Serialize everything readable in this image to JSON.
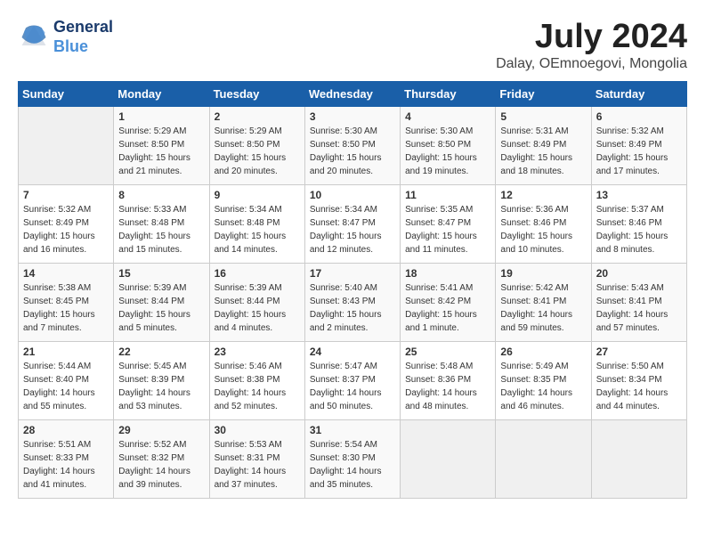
{
  "logo": {
    "line1": "General",
    "line2": "Blue"
  },
  "title": "July 2024",
  "subtitle": "Dalay, OEmnoegovi, Mongolia",
  "weekdays": [
    "Sunday",
    "Monday",
    "Tuesday",
    "Wednesday",
    "Thursday",
    "Friday",
    "Saturday"
  ],
  "weeks": [
    [
      {
        "day": "",
        "info": ""
      },
      {
        "day": "1",
        "info": "Sunrise: 5:29 AM\nSunset: 8:50 PM\nDaylight: 15 hours\nand 21 minutes."
      },
      {
        "day": "2",
        "info": "Sunrise: 5:29 AM\nSunset: 8:50 PM\nDaylight: 15 hours\nand 20 minutes."
      },
      {
        "day": "3",
        "info": "Sunrise: 5:30 AM\nSunset: 8:50 PM\nDaylight: 15 hours\nand 20 minutes."
      },
      {
        "day": "4",
        "info": "Sunrise: 5:30 AM\nSunset: 8:50 PM\nDaylight: 15 hours\nand 19 minutes."
      },
      {
        "day": "5",
        "info": "Sunrise: 5:31 AM\nSunset: 8:49 PM\nDaylight: 15 hours\nand 18 minutes."
      },
      {
        "day": "6",
        "info": "Sunrise: 5:32 AM\nSunset: 8:49 PM\nDaylight: 15 hours\nand 17 minutes."
      }
    ],
    [
      {
        "day": "7",
        "info": "Sunrise: 5:32 AM\nSunset: 8:49 PM\nDaylight: 15 hours\nand 16 minutes."
      },
      {
        "day": "8",
        "info": "Sunrise: 5:33 AM\nSunset: 8:48 PM\nDaylight: 15 hours\nand 15 minutes."
      },
      {
        "day": "9",
        "info": "Sunrise: 5:34 AM\nSunset: 8:48 PM\nDaylight: 15 hours\nand 14 minutes."
      },
      {
        "day": "10",
        "info": "Sunrise: 5:34 AM\nSunset: 8:47 PM\nDaylight: 15 hours\nand 12 minutes."
      },
      {
        "day": "11",
        "info": "Sunrise: 5:35 AM\nSunset: 8:47 PM\nDaylight: 15 hours\nand 11 minutes."
      },
      {
        "day": "12",
        "info": "Sunrise: 5:36 AM\nSunset: 8:46 PM\nDaylight: 15 hours\nand 10 minutes."
      },
      {
        "day": "13",
        "info": "Sunrise: 5:37 AM\nSunset: 8:46 PM\nDaylight: 15 hours\nand 8 minutes."
      }
    ],
    [
      {
        "day": "14",
        "info": "Sunrise: 5:38 AM\nSunset: 8:45 PM\nDaylight: 15 hours\nand 7 minutes."
      },
      {
        "day": "15",
        "info": "Sunrise: 5:39 AM\nSunset: 8:44 PM\nDaylight: 15 hours\nand 5 minutes."
      },
      {
        "day": "16",
        "info": "Sunrise: 5:39 AM\nSunset: 8:44 PM\nDaylight: 15 hours\nand 4 minutes."
      },
      {
        "day": "17",
        "info": "Sunrise: 5:40 AM\nSunset: 8:43 PM\nDaylight: 15 hours\nand 2 minutes."
      },
      {
        "day": "18",
        "info": "Sunrise: 5:41 AM\nSunset: 8:42 PM\nDaylight: 15 hours\nand 1 minute."
      },
      {
        "day": "19",
        "info": "Sunrise: 5:42 AM\nSunset: 8:41 PM\nDaylight: 14 hours\nand 59 minutes."
      },
      {
        "day": "20",
        "info": "Sunrise: 5:43 AM\nSunset: 8:41 PM\nDaylight: 14 hours\nand 57 minutes."
      }
    ],
    [
      {
        "day": "21",
        "info": "Sunrise: 5:44 AM\nSunset: 8:40 PM\nDaylight: 14 hours\nand 55 minutes."
      },
      {
        "day": "22",
        "info": "Sunrise: 5:45 AM\nSunset: 8:39 PM\nDaylight: 14 hours\nand 53 minutes."
      },
      {
        "day": "23",
        "info": "Sunrise: 5:46 AM\nSunset: 8:38 PM\nDaylight: 14 hours\nand 52 minutes."
      },
      {
        "day": "24",
        "info": "Sunrise: 5:47 AM\nSunset: 8:37 PM\nDaylight: 14 hours\nand 50 minutes."
      },
      {
        "day": "25",
        "info": "Sunrise: 5:48 AM\nSunset: 8:36 PM\nDaylight: 14 hours\nand 48 minutes."
      },
      {
        "day": "26",
        "info": "Sunrise: 5:49 AM\nSunset: 8:35 PM\nDaylight: 14 hours\nand 46 minutes."
      },
      {
        "day": "27",
        "info": "Sunrise: 5:50 AM\nSunset: 8:34 PM\nDaylight: 14 hours\nand 44 minutes."
      }
    ],
    [
      {
        "day": "28",
        "info": "Sunrise: 5:51 AM\nSunset: 8:33 PM\nDaylight: 14 hours\nand 41 minutes."
      },
      {
        "day": "29",
        "info": "Sunrise: 5:52 AM\nSunset: 8:32 PM\nDaylight: 14 hours\nand 39 minutes."
      },
      {
        "day": "30",
        "info": "Sunrise: 5:53 AM\nSunset: 8:31 PM\nDaylight: 14 hours\nand 37 minutes."
      },
      {
        "day": "31",
        "info": "Sunrise: 5:54 AM\nSunset: 8:30 PM\nDaylight: 14 hours\nand 35 minutes."
      },
      {
        "day": "",
        "info": ""
      },
      {
        "day": "",
        "info": ""
      },
      {
        "day": "",
        "info": ""
      }
    ]
  ]
}
